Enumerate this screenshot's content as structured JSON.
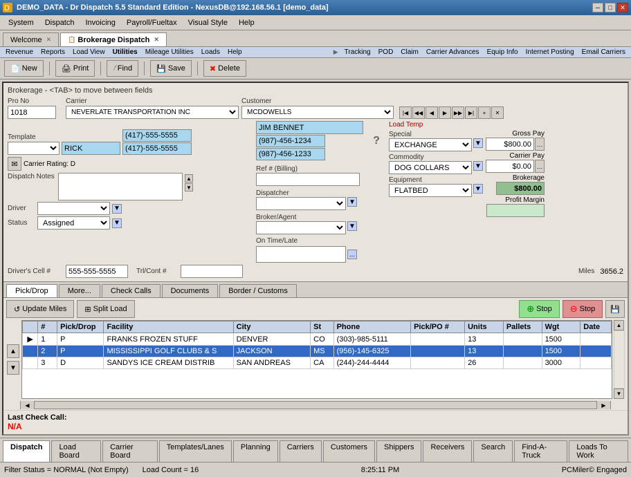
{
  "window": {
    "title": "DEMO_DATA - Dr Dispatch 5.5 Standard Edition - NexusDB@192.168.56.1 [demo_data]",
    "min_btn": "─",
    "max_btn": "□",
    "close_btn": "✕"
  },
  "menu": {
    "items": [
      "System",
      "Dispatch",
      "Invoicing",
      "Payroll/Fueltax",
      "Visual Style",
      "Help"
    ]
  },
  "tabs": [
    {
      "label": "Welcome",
      "active": false
    },
    {
      "label": "Brokerage Dispatch",
      "active": true
    }
  ],
  "sub_menu": {
    "items": [
      "Revenue",
      "Reports",
      "Load View",
      "Utilities",
      "Mileage Utilities",
      "Loads",
      "Help"
    ],
    "right_items": [
      "Tracking",
      "POD",
      "Claim",
      "Carrier Advances",
      "Equip Info",
      "Internet Posting",
      "Email Carriers"
    ]
  },
  "toolbar": {
    "new_label": "New",
    "print_label": "Print",
    "find_label": "Find",
    "save_label": "Save",
    "delete_label": "Delete"
  },
  "form": {
    "header": "Brokerage - <TAB> to move between fields",
    "pro_no_label": "Pro No",
    "pro_no_value": "1018",
    "carrier_label": "Carrier",
    "carrier_value": "NEVERLATE TRANSPORTATION INC",
    "customer_label": "Customer",
    "customer_value": "MCDOWELLS",
    "template_label": "Template",
    "driver_name": "RICK",
    "phone1": "(417)-555-5555",
    "phone2": "(417)-555-5555",
    "contact_name": "JIM BENNET",
    "contact_phone1": "(987)-456-1234",
    "contact_phone2": "(987)-456-1233",
    "carrier_rating": "Carrier Rating: D",
    "dispatch_notes_label": "Dispatch Notes",
    "driver_label": "Driver",
    "status_label": "Status",
    "status_value": "Assigned",
    "ref_billing_label": "Ref # (Billing)",
    "dispatcher_label": "Dispatcher",
    "broker_agent_label": "Broker/Agent",
    "on_time_late_label": "On Time/Late",
    "special_label": "Special",
    "special_value": "EXCHANGE",
    "commodity_label": "Commodity",
    "commodity_value": "DOG COLLARS",
    "equipment_label": "Equipment",
    "equipment_value": "FLATBED",
    "gross_pay_label": "Gross Pay",
    "gross_pay_value": "$800.00",
    "carrier_pay_label": "Carrier Pay",
    "carrier_pay_value": "$0.00",
    "brokerage_label": "Brokerage",
    "brokerage_value": "$800.00",
    "profit_margin_label": "Profit Margin",
    "drivers_cell_label": "Driver's Cell #",
    "drivers_cell_value": "555-555-5555",
    "trl_cont_label": "Trl/Cont #",
    "miles_label": "Miles",
    "miles_value": "3656.2",
    "load_temp_label": "Load Temp"
  },
  "content_tabs": [
    {
      "label": "Pick/Drop",
      "active": true
    },
    {
      "label": "More...",
      "active": false
    },
    {
      "label": "Check Calls",
      "active": false
    },
    {
      "label": "Documents",
      "active": false
    },
    {
      "label": "Border / Customs",
      "active": false
    }
  ],
  "action_buttons": {
    "update_miles": "Update Miles",
    "split_load": "Split Load",
    "stop_green": "Stop",
    "stop_red": "Stop"
  },
  "table": {
    "columns": [
      "#",
      "Pick/Drop",
      "Facility",
      "City",
      "St",
      "Phone",
      "Pick/PO #",
      "Units",
      "Pallets",
      "Wgt",
      "Date"
    ],
    "rows": [
      {
        "num": "1",
        "type": "P",
        "facility": "FRANKS FROZEN STUFF",
        "city": "DENVER",
        "state": "CO",
        "phone": "(303)-985-5111",
        "pick_po": "",
        "units": "13",
        "pallets": "",
        "wgt": "1500",
        "date": "",
        "selected": false,
        "indicator": "▶"
      },
      {
        "num": "2",
        "type": "P",
        "facility": "MISSISSIPPI GOLF CLUBS & S",
        "city": "JACKSON",
        "state": "MS",
        "phone": "(956)-145-6325",
        "pick_po": "",
        "units": "13",
        "pallets": "",
        "wgt": "1500",
        "date": "",
        "selected": true,
        "indicator": ""
      },
      {
        "num": "3",
        "type": "D",
        "facility": "SANDYS ICE CREAM DISTRIB",
        "city": "SAN ANDREAS",
        "state": "CA",
        "phone": "(244)-244-4444",
        "pick_po": "",
        "units": "26",
        "pallets": "",
        "wgt": "3000",
        "date": "",
        "selected": false,
        "indicator": ""
      }
    ]
  },
  "check_call": {
    "label": "Last Check Call:",
    "value": "N/A"
  },
  "bottom_tabs": [
    {
      "label": "Dispatch",
      "active": true
    },
    {
      "label": "Load Board",
      "active": false
    },
    {
      "label": "Carrier Board",
      "active": false
    },
    {
      "label": "Templates/Lanes",
      "active": false
    },
    {
      "label": "Planning",
      "active": false
    },
    {
      "label": "Carriers",
      "active": false
    },
    {
      "label": "Customers",
      "active": false
    },
    {
      "label": "Shippers",
      "active": false
    },
    {
      "label": "Receivers",
      "active": false
    },
    {
      "label": "Search",
      "active": false
    },
    {
      "label": "Find-A-Truck",
      "active": false
    },
    {
      "label": "Loads To Work",
      "active": false
    }
  ],
  "status_bar": {
    "filter_status": "Filter Status = NORMAL (Not Empty)",
    "load_count": "Load Count = 16",
    "time": "8:25:11 PM",
    "pcmiler": "PCMiler© Engaged"
  }
}
